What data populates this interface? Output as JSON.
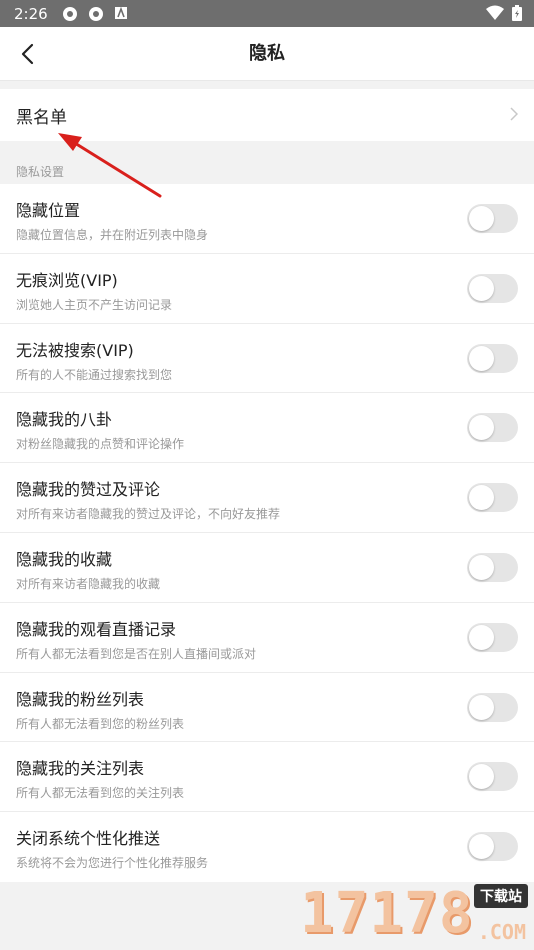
{
  "status_bar": {
    "time": "2:26"
  },
  "header": {
    "title": "隐私"
  },
  "blacklist": {
    "label": "黑名单"
  },
  "section": {
    "label": "隐私设置"
  },
  "toggles": [
    {
      "title": "隐藏位置",
      "subtitle": "隐藏位置信息，并在附近列表中隐身",
      "on": false
    },
    {
      "title": "无痕浏览(VIP)",
      "subtitle": "浏览她人主页不产生访问记录",
      "on": false
    },
    {
      "title": "无法被搜索(VIP)",
      "subtitle": "所有的人不能通过搜索找到您",
      "on": false
    },
    {
      "title": "隐藏我的八卦",
      "subtitle": "对粉丝隐藏我的点赞和评论操作",
      "on": false
    },
    {
      "title": "隐藏我的赞过及评论",
      "subtitle": "对所有来访者隐藏我的赞过及评论，不向好友推荐",
      "on": false
    },
    {
      "title": "隐藏我的收藏",
      "subtitle": "对所有来访者隐藏我的收藏",
      "on": false
    },
    {
      "title": "隐藏我的观看直播记录",
      "subtitle": "所有人都无法看到您是否在别人直播间或派对",
      "on": false
    },
    {
      "title": "隐藏我的粉丝列表",
      "subtitle": "所有人都无法看到您的粉丝列表",
      "on": false
    },
    {
      "title": "隐藏我的关注列表",
      "subtitle": "所有人都无法看到您的关注列表",
      "on": false
    },
    {
      "title": "关闭系统个性化推送",
      "subtitle": "系统将不会为您进行个性化推荐服务",
      "on": false
    }
  ],
  "watermark": {
    "number": "17178",
    "tag": "下载站",
    "domain": ".COM"
  },
  "colors": {
    "annotation_arrow": "#d9201c",
    "switch_off": "#e5e5e5"
  }
}
